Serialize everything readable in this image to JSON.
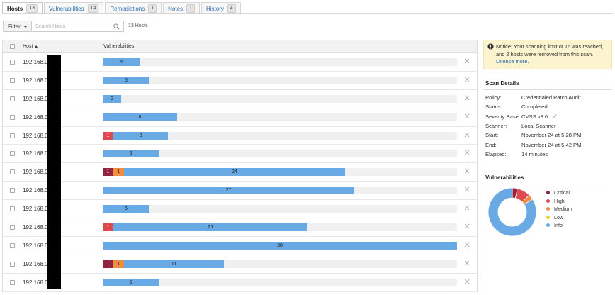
{
  "tabs": [
    {
      "label": "Hosts",
      "count": "13",
      "active": true
    },
    {
      "label": "Vulnerabilities",
      "count": "14"
    },
    {
      "label": "Remediations",
      "count": "1"
    },
    {
      "label": "Notes",
      "count": "1"
    },
    {
      "label": "History",
      "count": "4"
    }
  ],
  "toolbar": {
    "filter_label": "Filter",
    "search_placeholder": "Search Hosts",
    "host_count": "13 Hosts"
  },
  "table": {
    "col_host": "Host",
    "col_vulns": "Vulnerabilities",
    "max_total": 38,
    "rows": [
      {
        "host": "192.168.0.1",
        "critical": 0,
        "high": 0,
        "medium": 0,
        "info": 4
      },
      {
        "host": "192.168.0.1",
        "critical": 0,
        "high": 0,
        "medium": 0,
        "info": 5
      },
      {
        "host": "192.168.0.1",
        "critical": 0,
        "high": 0,
        "medium": 0,
        "info": 2
      },
      {
        "host": "192.168.0.2",
        "critical": 0,
        "high": 0,
        "medium": 0,
        "info": 8
      },
      {
        "host": "192.168.0.2",
        "critical": 0,
        "high": 1,
        "medium": 0,
        "info": 6
      },
      {
        "host": "192.168.0.3",
        "critical": 0,
        "high": 0,
        "medium": 0,
        "info": 6
      },
      {
        "host": "192.168.0.4",
        "critical": 1,
        "high": 0,
        "medium": 1,
        "info": 24
      },
      {
        "host": "192.168.0.4",
        "critical": 0,
        "high": 0,
        "medium": 0,
        "info": 27
      },
      {
        "host": "192.168.0.4",
        "critical": 0,
        "high": 0,
        "medium": 0,
        "info": 5
      },
      {
        "host": "192.168.0.4",
        "critical": 0,
        "high": 1,
        "medium": 0,
        "info": 21
      },
      {
        "host": "192.168.0.9",
        "critical": 0,
        "high": 0,
        "medium": 0,
        "info": 38
      },
      {
        "host": "192.168.0.1",
        "critical": 1,
        "high": 0,
        "medium": 1,
        "info": 11
      },
      {
        "host": "192.168.0.2",
        "critical": 0,
        "high": 0,
        "medium": 0,
        "info": 6
      }
    ]
  },
  "notice": {
    "text": "Notice: Your scanning limit of 16 was reached, and 2 hosts were removed from this scan.",
    "link": "License more."
  },
  "scan_details": {
    "title": "Scan Details",
    "items": [
      {
        "label": "Policy:",
        "value": "Credentialed Patch Audit"
      },
      {
        "label": "Status:",
        "value": "Completed"
      },
      {
        "label": "Severity Base:",
        "value": "CVSS v3.0"
      },
      {
        "label": "Scanner:",
        "value": "Local Scanner"
      },
      {
        "label": "Start:",
        "value": "November 24 at 5:28 PM"
      },
      {
        "label": "End:",
        "value": "November 24 at 5:42 PM"
      },
      {
        "label": "Elapsed:",
        "value": "14 minutes"
      }
    ]
  },
  "vulnerabilities": {
    "title": "Vulnerabilities",
    "legend": [
      {
        "label": "Critical",
        "color": "#91243e",
        "share": 0.035
      },
      {
        "label": "High",
        "color": "#dd4b50",
        "share": 0.09
      },
      {
        "label": "Medium",
        "color": "#f18c43",
        "share": 0.035
      },
      {
        "label": "Low",
        "color": "#fdc931",
        "share": 0.0
      },
      {
        "label": "Info",
        "color": "#6aaae4",
        "share": 0.84
      }
    ]
  }
}
